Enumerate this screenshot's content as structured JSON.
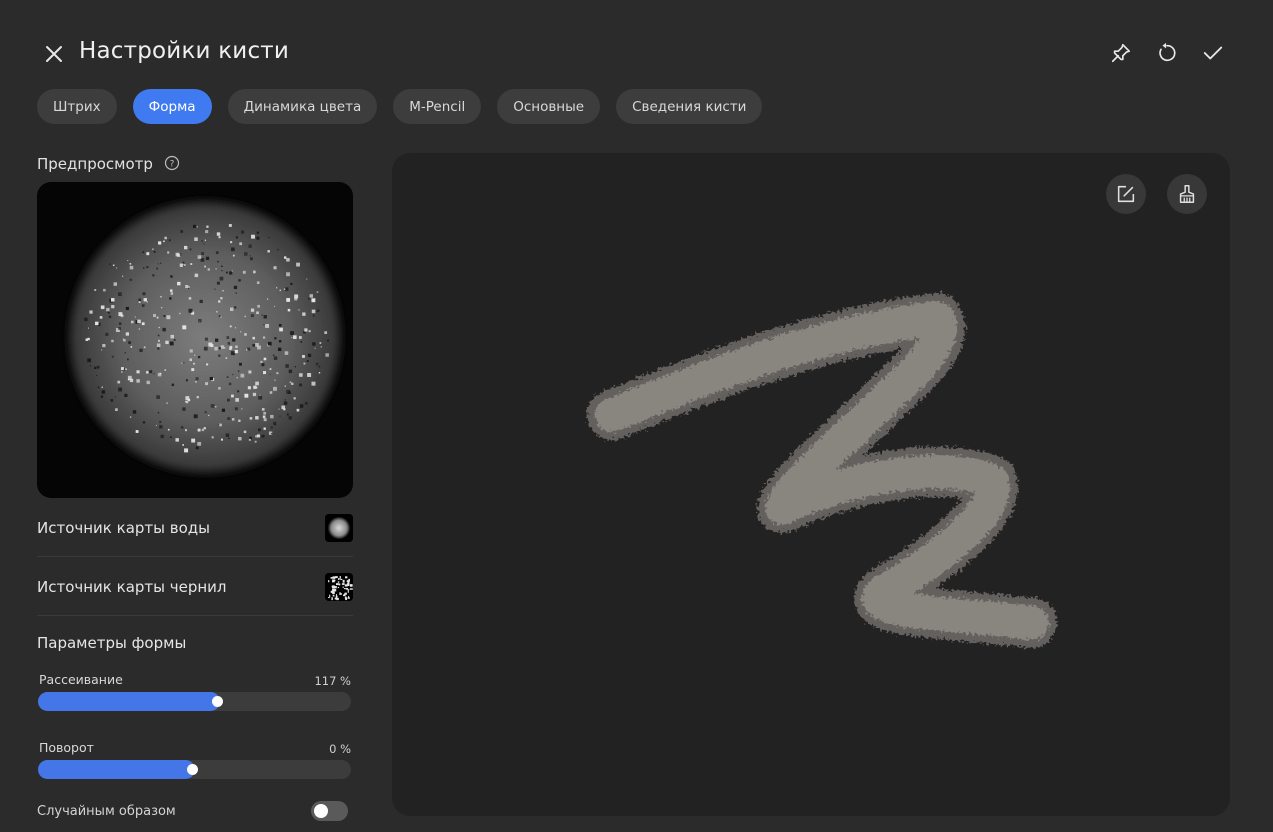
{
  "header": {
    "title": "Настройки кисти",
    "icons": {
      "close": "close-icon",
      "pin": "pin-icon",
      "reset": "reset-icon",
      "confirm": "check-icon"
    }
  },
  "tabs": [
    {
      "label": "Штрих",
      "active": false
    },
    {
      "label": "Форма",
      "active": true
    },
    {
      "label": "Динамика цвета",
      "active": false
    },
    {
      "label": "M-Pencil",
      "active": false
    },
    {
      "label": "Основные",
      "active": false
    },
    {
      "label": "Сведения кисти",
      "active": false
    }
  ],
  "preview": {
    "label": "Предпросмотр",
    "help_icon": "help-icon"
  },
  "sources": {
    "water": {
      "label": "Источник карты воды"
    },
    "ink": {
      "label": "Источник карты чернил"
    }
  },
  "shape_params": {
    "title": "Параметры формы",
    "scatter": {
      "label": "Рассеивание",
      "value": "117 %",
      "fill": 0.58
    },
    "rotation": {
      "label": "Поворот",
      "value": "0 %",
      "fill": 0.5
    },
    "random": {
      "label": "Случайным образом",
      "on": false
    }
  },
  "canvas": {
    "icons": {
      "edit": "edit-icon",
      "clear": "broom-icon"
    }
  },
  "colors": {
    "accent": "#3f7af0",
    "background": "#2b2b2b",
    "canvas": "#222222",
    "stroke": "#8a8682"
  }
}
